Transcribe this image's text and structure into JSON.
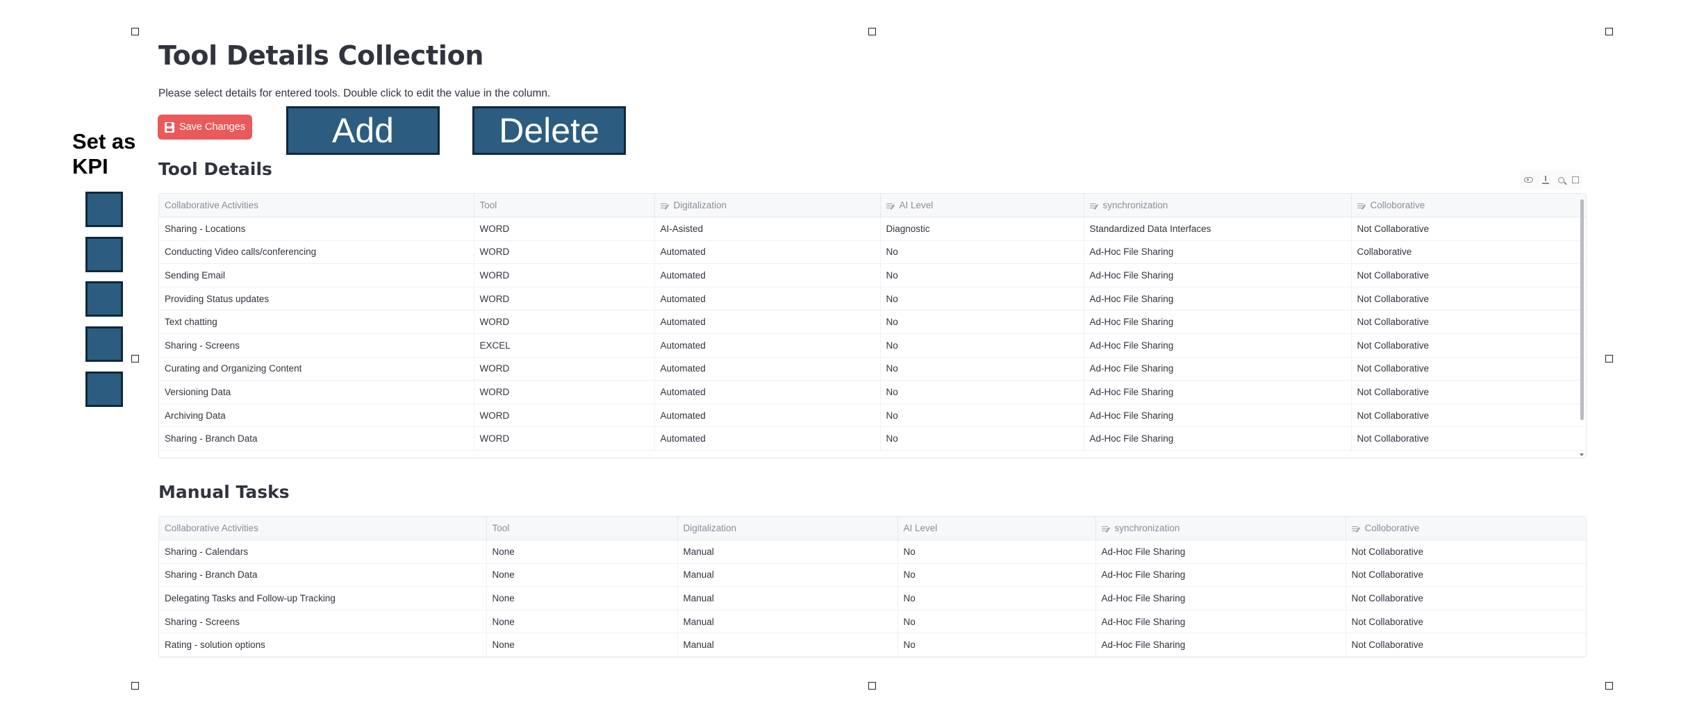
{
  "page": {
    "title": "Tool Details Collection",
    "subtitle": "Please select details for entered tools. Double click to edit the value in the column.",
    "save_label": "Save Changes",
    "add_label": "Add",
    "delete_label": "Delete",
    "kpi_label": "Set as KPI",
    "kpi_checkbox_count": 5
  },
  "colors": {
    "accent_red": "#ea5a5a",
    "button_blue": "#2c5d81",
    "button_border": "#10283a"
  },
  "tool_details": {
    "title": "Tool Details",
    "toolbar_icons": [
      "eye-icon",
      "download-icon",
      "search-icon",
      "fullscreen-icon"
    ],
    "columns": [
      {
        "label": "Collaborative Activities",
        "editable": false
      },
      {
        "label": "Tool",
        "editable": false
      },
      {
        "label": "Digitalization",
        "editable": true
      },
      {
        "label": "AI Level",
        "editable": true
      },
      {
        "label": "synchronization",
        "editable": true
      },
      {
        "label": "Colloborative",
        "editable": true
      }
    ],
    "rows": [
      [
        "Sharing - Locations",
        "WORD",
        "AI-Asisted",
        "Diagnostic",
        "Standardized Data Interfaces",
        "Not Collaborative"
      ],
      [
        "Conducting Video calls/conferencing",
        "WORD",
        "Automated",
        "No",
        "Ad-Hoc File Sharing",
        "Collaborative"
      ],
      [
        "Sending Email",
        "WORD",
        "Automated",
        "No",
        "Ad-Hoc File Sharing",
        "Not Collaborative"
      ],
      [
        "Providing Status updates",
        "WORD",
        "Automated",
        "No",
        "Ad-Hoc File Sharing",
        "Not Collaborative"
      ],
      [
        "Text chatting",
        "WORD",
        "Automated",
        "No",
        "Ad-Hoc File Sharing",
        "Not Collaborative"
      ],
      [
        "Sharing - Screens",
        "EXCEL",
        "Automated",
        "No",
        "Ad-Hoc File Sharing",
        "Not Collaborative"
      ],
      [
        "Curating and Organizing Content",
        "WORD",
        "Automated",
        "No",
        "Ad-Hoc File Sharing",
        "Not Collaborative"
      ],
      [
        "Versioning Data",
        "WORD",
        "Automated",
        "No",
        "Ad-Hoc File Sharing",
        "Not Collaborative"
      ],
      [
        "Archiving Data",
        "WORD",
        "Automated",
        "No",
        "Ad-Hoc File Sharing",
        "Not Collaborative"
      ],
      [
        "Sharing - Branch Data",
        "WORD",
        "Automated",
        "No",
        "Ad-Hoc File Sharing",
        "Not Collaborative"
      ]
    ]
  },
  "manual_tasks": {
    "title": "Manual Tasks",
    "columns": [
      {
        "label": "Collaborative Activities",
        "editable": false
      },
      {
        "label": "Tool",
        "editable": false
      },
      {
        "label": "Digitalization",
        "editable": false
      },
      {
        "label": "AI Level",
        "editable": false
      },
      {
        "label": "synchronization",
        "editable": true
      },
      {
        "label": "Colloborative",
        "editable": true
      }
    ],
    "rows": [
      [
        "Sharing - Calendars",
        "None",
        "Manual",
        "No",
        "Ad-Hoc File Sharing",
        "Not Collaborative"
      ],
      [
        "Sharing - Branch Data",
        "None",
        "Manual",
        "No",
        "Ad-Hoc File Sharing",
        "Not Collaborative"
      ],
      [
        "Delegating Tasks and Follow-up Tracking",
        "None",
        "Manual",
        "No",
        "Ad-Hoc File Sharing",
        "Not Collaborative"
      ],
      [
        "Sharing - Screens",
        "None",
        "Manual",
        "No",
        "Ad-Hoc File Sharing",
        "Not Collaborative"
      ],
      [
        "Rating - solution options",
        "None",
        "Manual",
        "No",
        "Ad-Hoc File Sharing",
        "Not Collaborative"
      ]
    ]
  }
}
